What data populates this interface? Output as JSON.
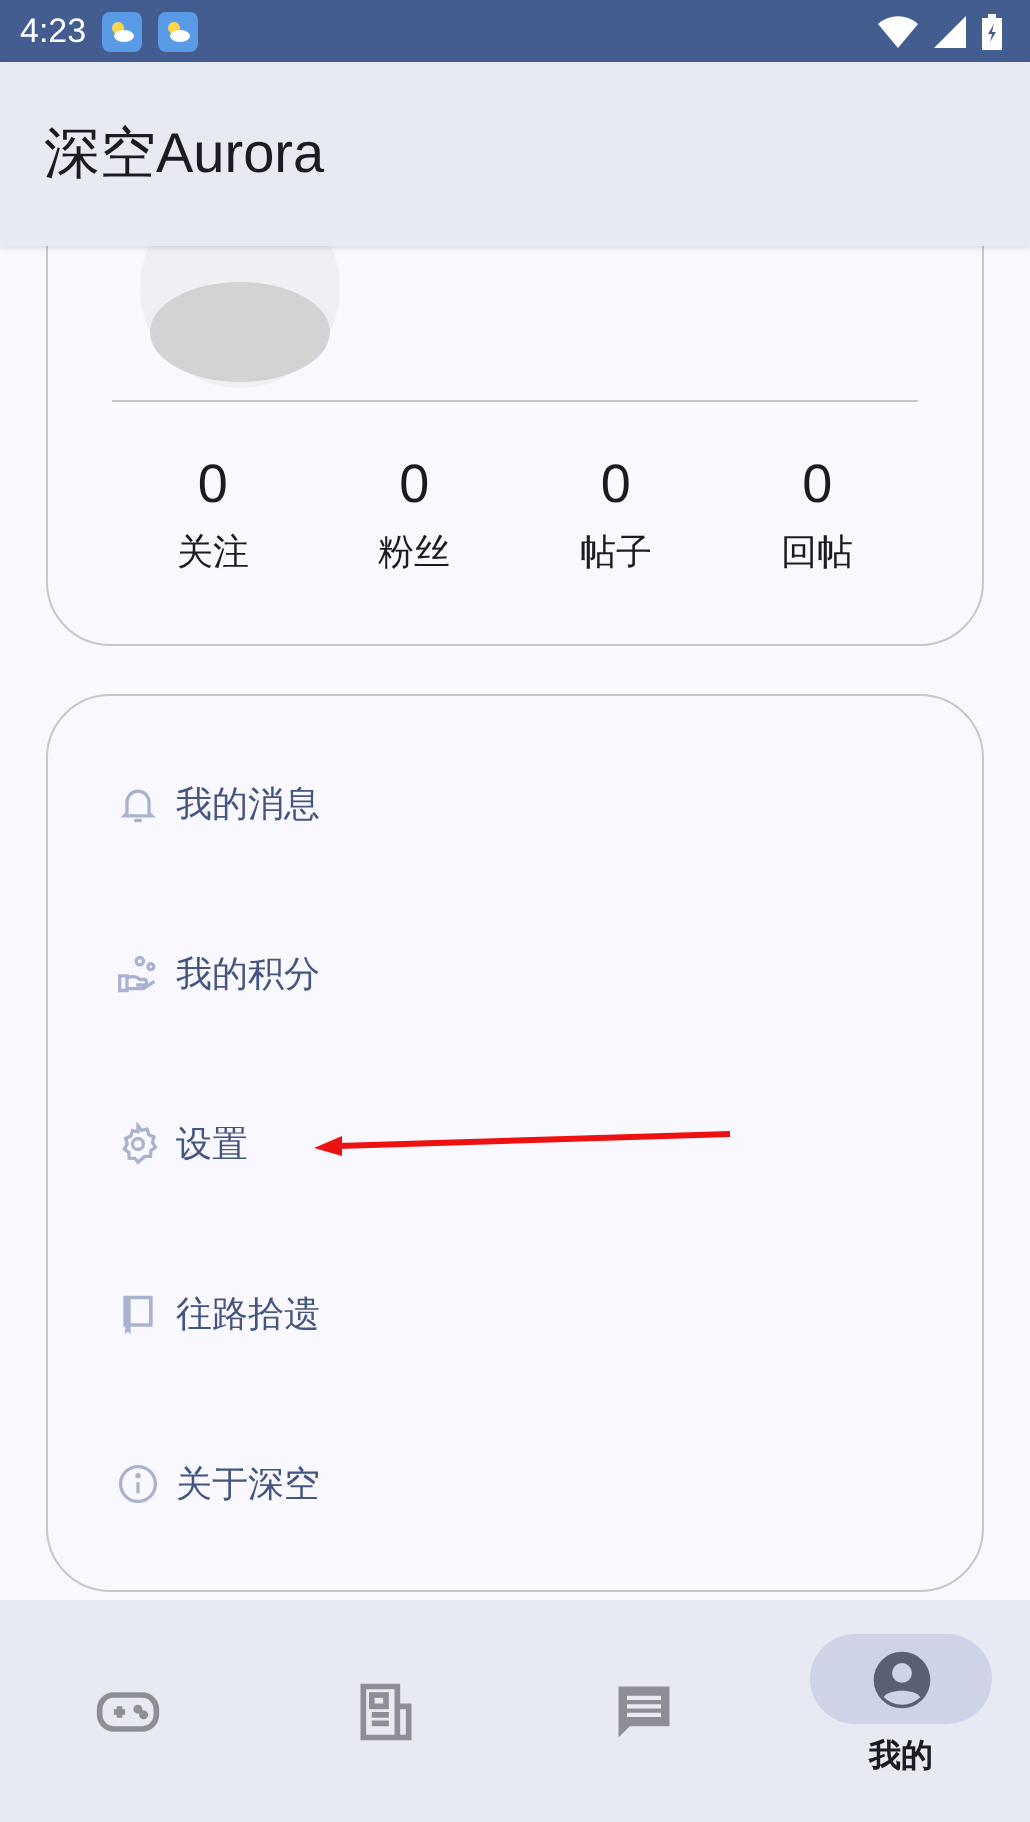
{
  "status_bar": {
    "time": "4:23",
    "notifications": [
      {
        "kind": "weather"
      },
      {
        "kind": "weather"
      }
    ]
  },
  "app_bar": {
    "title": "深空Aurora"
  },
  "profile": {
    "stats": [
      {
        "value": "0",
        "label": "关注"
      },
      {
        "value": "0",
        "label": "粉丝"
      },
      {
        "value": "0",
        "label": "帖子"
      },
      {
        "value": "0",
        "label": "回帖"
      }
    ]
  },
  "menu": [
    {
      "kind": "bell",
      "label": "我的消息"
    },
    {
      "kind": "points",
      "label": "我的积分"
    },
    {
      "kind": "gear",
      "label": "设置"
    },
    {
      "kind": "book",
      "label": "往路拾遗"
    },
    {
      "kind": "info",
      "label": "关于深空"
    }
  ],
  "annotation": {
    "kind": "arrow"
  },
  "bottom_nav": [
    {
      "kind": "gamepad",
      "selected": false
    },
    {
      "kind": "news",
      "selected": false
    },
    {
      "kind": "chat",
      "selected": false
    },
    {
      "kind": "person",
      "label": "我的",
      "selected": true
    }
  ]
}
